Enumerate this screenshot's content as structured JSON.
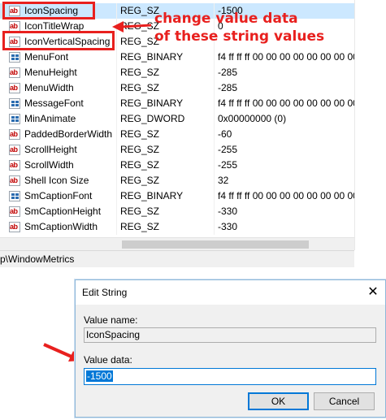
{
  "registry": {
    "rows": [
      {
        "name": "IconSpacing",
        "type": "REG_SZ",
        "data": "-1500",
        "icon": "string-value-icon",
        "selected": true
      },
      {
        "name": "IconTitleWrap",
        "type": "REG_SZ",
        "data": "0",
        "icon": "string-value-icon"
      },
      {
        "name": "IconVerticalSpacing",
        "type": "REG_SZ",
        "data": "",
        "icon": "string-value-icon"
      },
      {
        "name": "MenuFont",
        "type": "REG_BINARY",
        "data": "f4 ff ff ff 00 00 00 00 00 00 00 00 0",
        "icon": "binary-value-icon"
      },
      {
        "name": "MenuHeight",
        "type": "REG_SZ",
        "data": "-285",
        "icon": "string-value-icon"
      },
      {
        "name": "MenuWidth",
        "type": "REG_SZ",
        "data": "-285",
        "icon": "string-value-icon"
      },
      {
        "name": "MessageFont",
        "type": "REG_BINARY",
        "data": "f4 ff ff ff 00 00 00 00 00 00 00 00 0",
        "icon": "binary-value-icon"
      },
      {
        "name": "MinAnimate",
        "type": "REG_DWORD",
        "data": "0x00000000 (0)",
        "icon": "binary-value-icon"
      },
      {
        "name": "PaddedBorderWidth",
        "type": "REG_SZ",
        "data": "-60",
        "icon": "string-value-icon"
      },
      {
        "name": "ScrollHeight",
        "type": "REG_SZ",
        "data": "-255",
        "icon": "string-value-icon"
      },
      {
        "name": "ScrollWidth",
        "type": "REG_SZ",
        "data": "-255",
        "icon": "string-value-icon"
      },
      {
        "name": "Shell Icon Size",
        "type": "REG_SZ",
        "data": "32",
        "icon": "string-value-icon"
      },
      {
        "name": "SmCaptionFont",
        "type": "REG_BINARY",
        "data": "f4 ff ff ff 00 00 00 00 00 00 00 00 0",
        "icon": "binary-value-icon"
      },
      {
        "name": "SmCaptionHeight",
        "type": "REG_SZ",
        "data": "-330",
        "icon": "string-value-icon"
      },
      {
        "name": "SmCaptionWidth",
        "type": "REG_SZ",
        "data": "-330",
        "icon": "string-value-icon"
      }
    ],
    "status_path": "p\\WindowMetrics"
  },
  "annotation": {
    "line1": "change value data",
    "line2": "of these string values",
    "color": "#e8201e"
  },
  "dialog": {
    "title": "Edit String",
    "close_glyph": "✕",
    "value_name_label": "Value name:",
    "value_name": "IconSpacing",
    "value_data_label": "Value data:",
    "value_data": "-1500",
    "ok_label": "OK",
    "cancel_label": "Cancel"
  },
  "colors": {
    "selection": "#cce8ff",
    "accent": "#0078d7"
  }
}
